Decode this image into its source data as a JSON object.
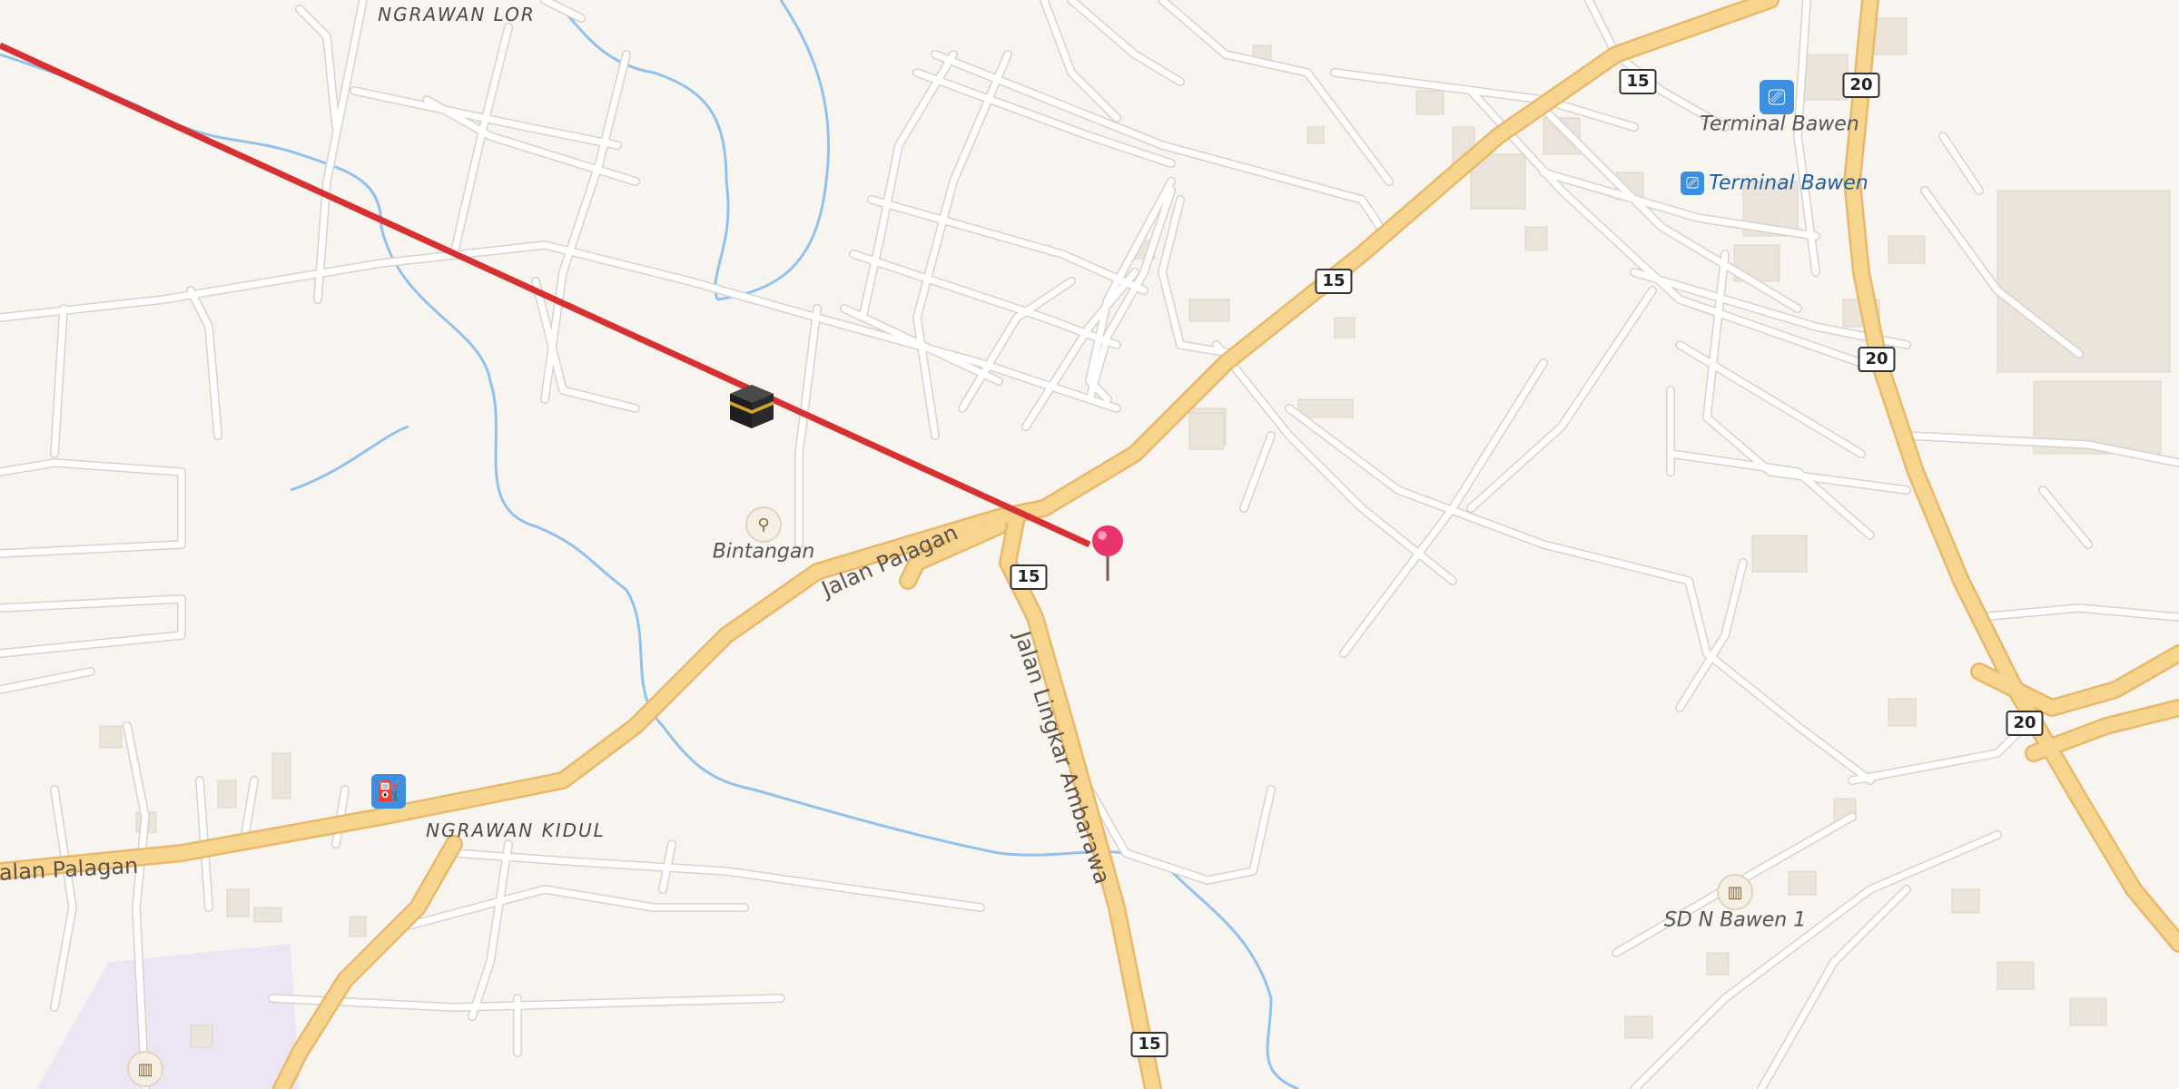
{
  "map": {
    "places": {
      "ngrawan_lor": "NGRAWAN LOR",
      "ngrawan_kidul": "NGRAWAN KIDUL"
    },
    "pois": {
      "bintangan": "Bintangan",
      "terminal_bawen_1": "Terminal Bawen",
      "terminal_bawen_2": "Terminal Bawen",
      "sd_n_bawen_1": "SD N Bawen 1"
    },
    "roads": {
      "jalan_palagan_1": "Jalan Palagan",
      "jalan_palagan_2": "Jalan Palagan",
      "jalan_lingkar_ambarawa": "Jalan Lingkar Ambarawa"
    },
    "shields": [
      "15",
      "15",
      "15",
      "15",
      "20",
      "20",
      "20"
    ],
    "icons": {
      "kaaba": "kaaba-icon",
      "pin": "location-pin-icon",
      "restaurant": "restaurant-icon",
      "bus": "bus-station-icon",
      "fuel": "fuel-station-icon",
      "school": "school-icon"
    },
    "colors": {
      "qibla_line": "#d63031",
      "pin": "#e8336b",
      "major_road": "#f7d58e",
      "major_road_casing": "#e8b96a",
      "minor_road": "#ffffff",
      "water": "#92c2ec",
      "background": "#f8f5f1"
    }
  }
}
